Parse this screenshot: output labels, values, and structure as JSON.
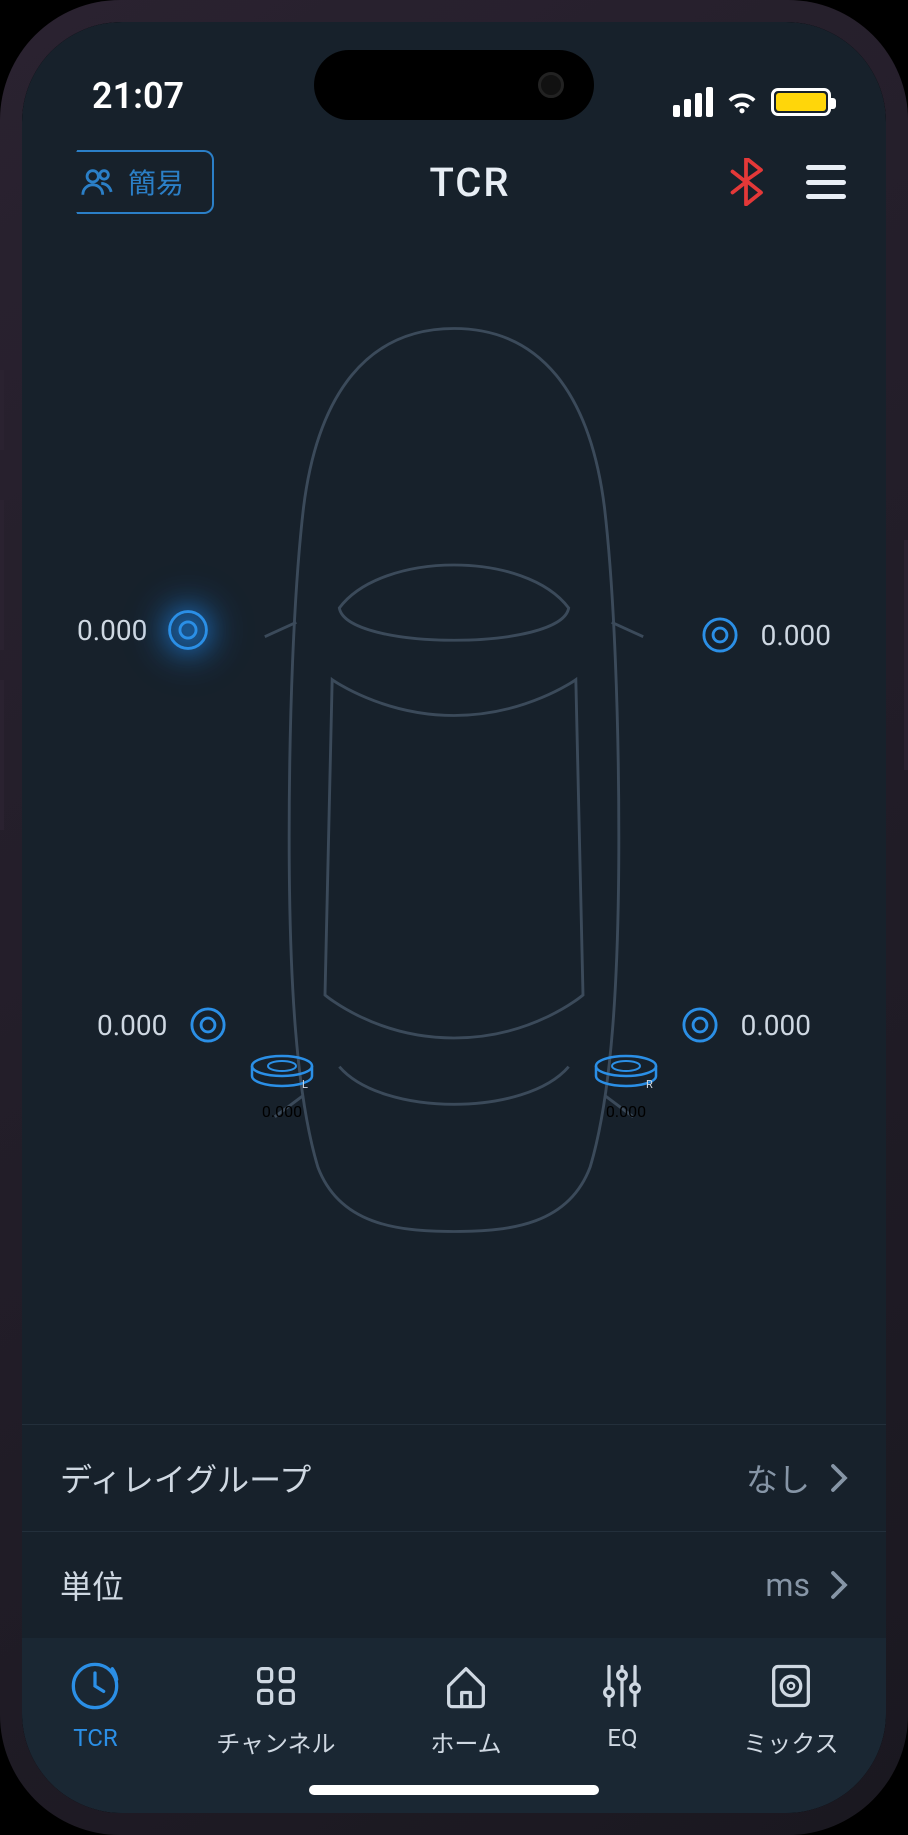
{
  "status": {
    "time": "21:07"
  },
  "header": {
    "profile_label": "簡易",
    "title": "TCR"
  },
  "speakers": {
    "front_left": "0.000",
    "front_right": "0.000",
    "rear_left": "0.000",
    "rear_right": "0.000",
    "sub_left": "0.000",
    "sub_right": "0.000"
  },
  "settings": {
    "delay_group": {
      "label": "ディレイグループ",
      "value": "なし"
    },
    "unit": {
      "label": "単位",
      "value": "ms"
    }
  },
  "tabs": {
    "tcr": "TCR",
    "channel": "チャンネル",
    "home": "ホーム",
    "eq": "EQ",
    "mix": "ミックス"
  }
}
